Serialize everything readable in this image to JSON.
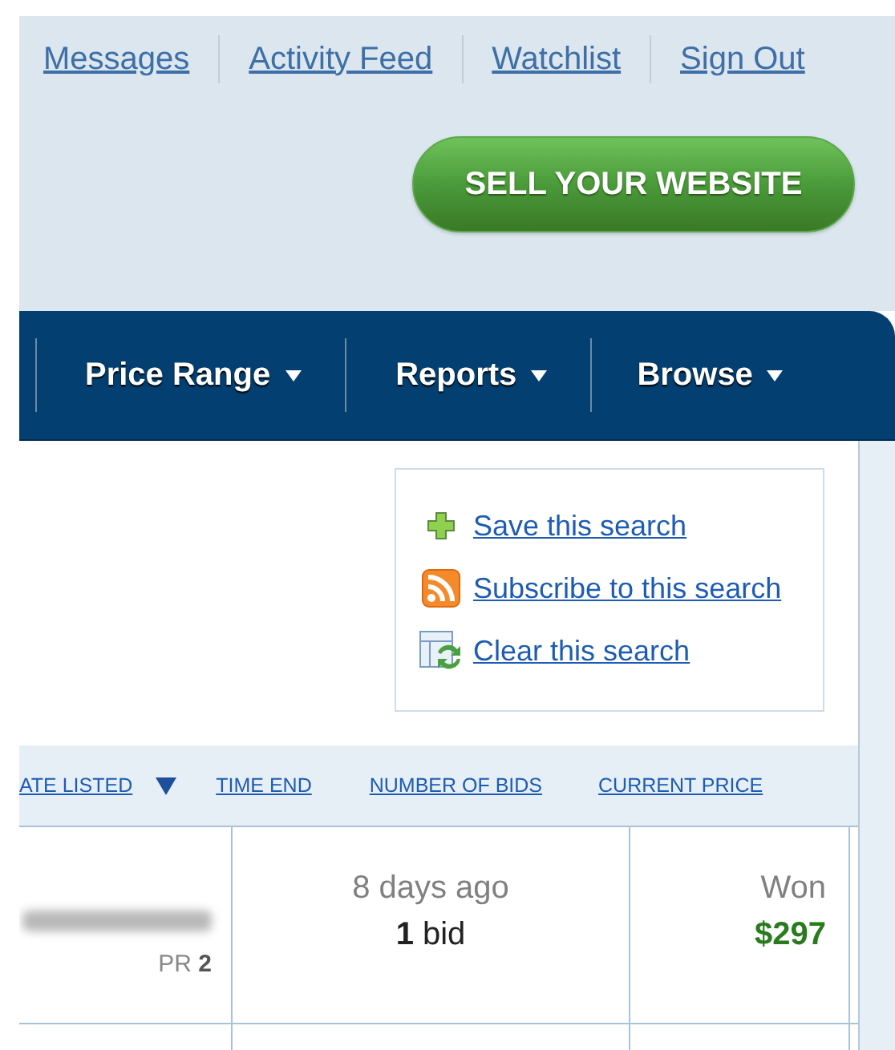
{
  "top_links": [
    {
      "label": "Messages"
    },
    {
      "label": "Activity Feed"
    },
    {
      "label": "Watchlist"
    },
    {
      "label": "Sign Out"
    }
  ],
  "sell_button": "SELL YOUR WEBSITE",
  "nav": [
    {
      "label": "Price Range"
    },
    {
      "label": "Reports"
    },
    {
      "label": "Browse"
    }
  ],
  "search_actions": [
    {
      "kind": "save",
      "label": "Save this search"
    },
    {
      "kind": "subscribe",
      "label": "Subscribe to this search"
    },
    {
      "kind": "clear",
      "label": "Clear this search"
    }
  ],
  "table": {
    "columns": [
      {
        "label": "ATE LISTED",
        "sorted": true
      },
      {
        "label": "TIME END",
        "sorted": false
      },
      {
        "label": "NUMBER OF BIDS",
        "sorted": false
      },
      {
        "label": "CURRENT PRICE",
        "sorted": false
      }
    ],
    "rows": [
      {
        "rank": "PR **2**",
        "time": "8 days ago",
        "bids": "**1** bid",
        "status": "Won",
        "price": "$297"
      }
    ]
  }
}
